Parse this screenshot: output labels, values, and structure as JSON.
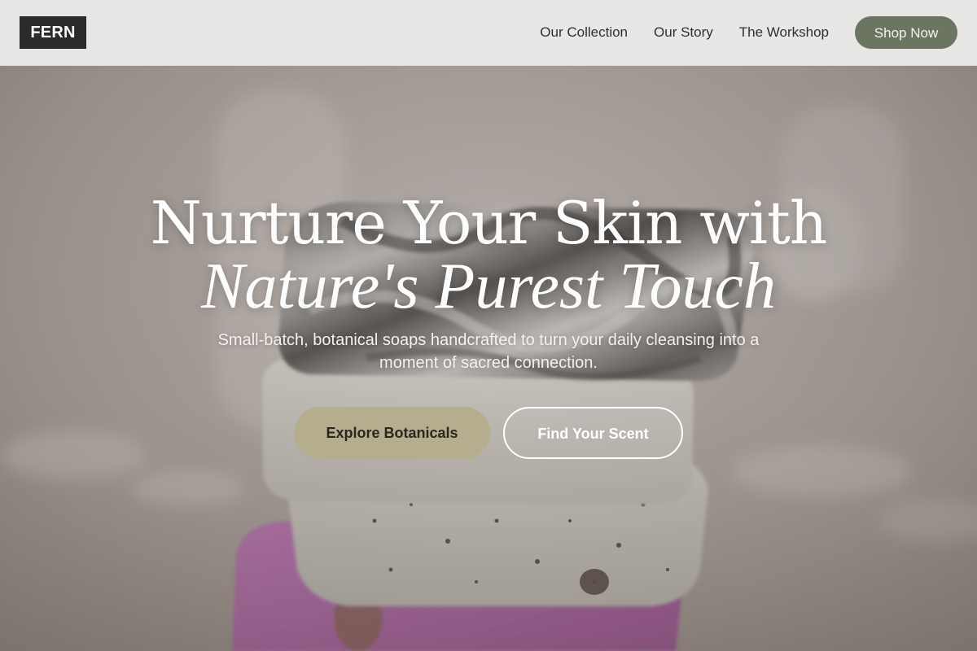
{
  "header": {
    "logo_text": "FERN",
    "nav": [
      {
        "label": "Our Collection"
      },
      {
        "label": "Our Story"
      },
      {
        "label": "The Workshop"
      }
    ],
    "cta_label": "Shop Now"
  },
  "hero": {
    "title_line1": "Nurture Your Skin with",
    "title_line2": "Nature's Purest Touch",
    "subtitle": "Small-batch, botanical soaps handcrafted to turn your daily cleansing into a moment of sacred connection.",
    "primary_button": "Explore Botanicals",
    "secondary_button": "Find Your Scent"
  },
  "colors": {
    "header_bg": "#e8e7e5",
    "logo_bg": "#2b2b2b",
    "shop_button_bg": "#6b7561",
    "primary_button_bg": "#b4ae8e",
    "hero_text": "#ffffff"
  }
}
